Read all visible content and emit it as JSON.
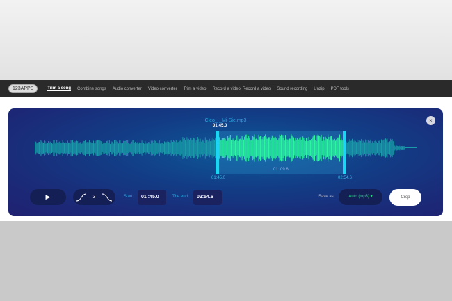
{
  "nav": {
    "logo": "123APPS",
    "items": [
      "Trim a song",
      "Combine songs",
      "Audio converter",
      "Video converter",
      "Trim a video",
      "Record a video",
      "Record a video",
      "Sound recording",
      "Unzip",
      "PDF tools"
    ]
  },
  "editor": {
    "file_name": "Cleo_-_Mi-Sie.mp3",
    "selection_start_top": "01:45.0",
    "selection_duration": "01: 09.6",
    "marker_start": "01:45.0",
    "marker_end": "02:54.6",
    "fade_value": "3",
    "start_label": "Start:",
    "start_value": "01 :45.0",
    "end_label": "The end:",
    "end_value": "02:54.6",
    "save_as_label": "Save as:",
    "format": "Auto (mp3)",
    "crop_label": "Crop",
    "close": "×",
    "play": "▶"
  },
  "colors": {
    "selected_wave": "#2bf5a0",
    "wave": "#1a9aa8",
    "handle": "#1fd3f2"
  }
}
